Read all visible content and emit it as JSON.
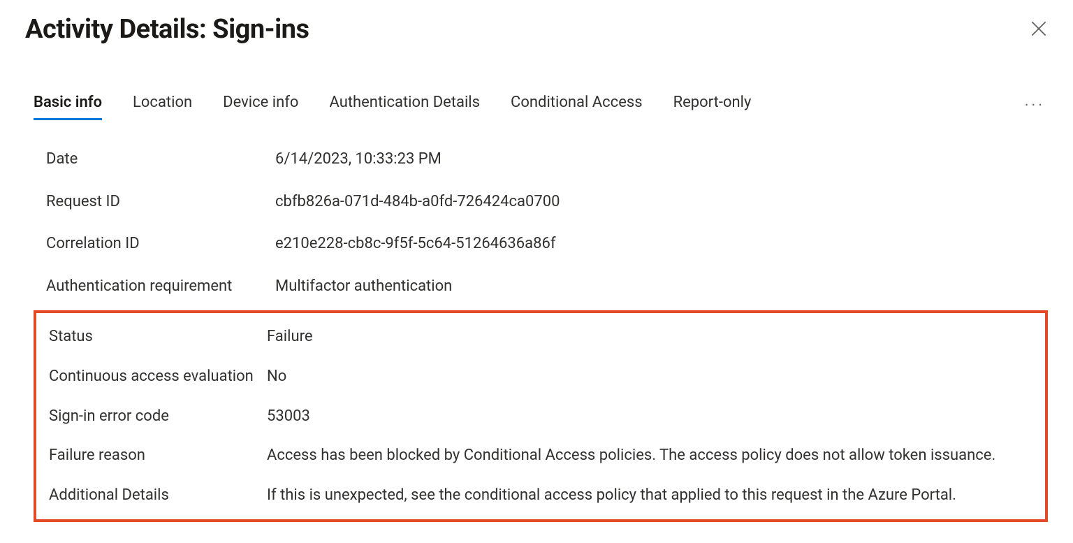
{
  "header": {
    "title": "Activity Details: Sign-ins"
  },
  "tabs": [
    {
      "label": "Basic info",
      "selected": true
    },
    {
      "label": "Location",
      "selected": false
    },
    {
      "label": "Device info",
      "selected": false
    },
    {
      "label": "Authentication Details",
      "selected": false
    },
    {
      "label": "Conditional Access",
      "selected": false
    },
    {
      "label": "Report-only",
      "selected": false
    }
  ],
  "details": {
    "date": {
      "label": "Date",
      "value": "6/14/2023, 10:33:23 PM"
    },
    "request_id": {
      "label": "Request ID",
      "value": "cbfb826a-071d-484b-a0fd-726424ca0700"
    },
    "correlation_id": {
      "label": "Correlation ID",
      "value": "e210e228-cb8c-9f5f-5c64-51264636a86f"
    },
    "auth_requirement": {
      "label": "Authentication requirement",
      "value": "Multifactor authentication"
    },
    "status": {
      "label": "Status",
      "value": "Failure"
    },
    "cae": {
      "label": "Continuous access evaluation",
      "value": "No"
    },
    "error_code": {
      "label": "Sign-in error code",
      "value": "53003"
    },
    "failure_reason": {
      "label": "Failure reason",
      "value": "Access has been blocked by Conditional Access policies. The access policy does not allow token issuance."
    },
    "additional_details": {
      "label": "Additional Details",
      "value": "If this is unexpected, see the conditional access policy that applied to this request in the Azure Portal."
    }
  }
}
